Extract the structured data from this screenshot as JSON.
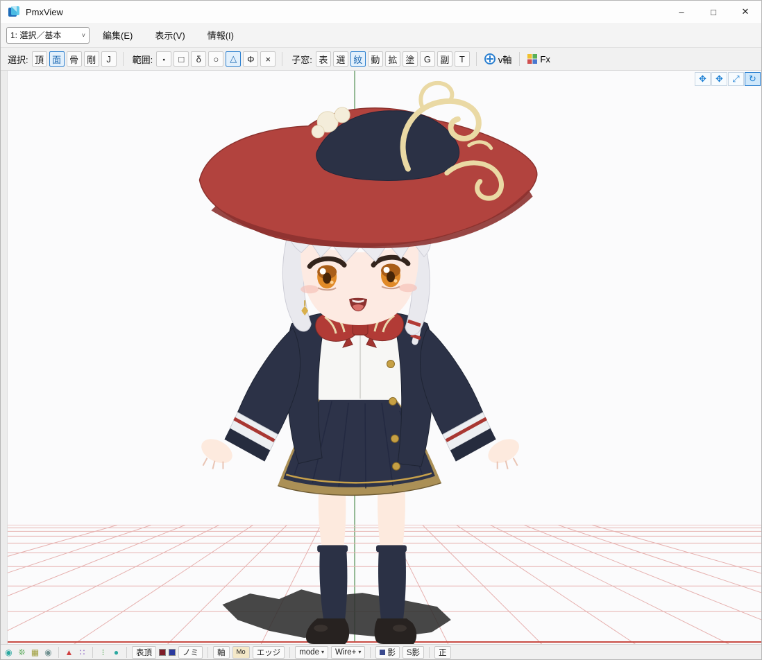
{
  "window": {
    "title": "PmxView",
    "minimize": "–",
    "maximize": "□",
    "close": "✕"
  },
  "menubar": {
    "mode_combo": {
      "value": "1: 選択／基本",
      "chevron": "˅"
    },
    "menus": [
      {
        "label": "編集(E)"
      },
      {
        "label": "表示(V)"
      },
      {
        "label": "情報(I)"
      }
    ]
  },
  "toolbar": {
    "select": {
      "label": "選択:",
      "buttons": [
        {
          "label": "頂",
          "selected": false
        },
        {
          "label": "面",
          "selected": true
        },
        {
          "label": "骨",
          "selected": false
        },
        {
          "label": "剛",
          "selected": false
        },
        {
          "label": "J",
          "selected": false
        }
      ]
    },
    "range": {
      "label": "範囲:",
      "buttons": [
        {
          "label": "・",
          "selected": false
        },
        {
          "label": "□",
          "selected": false
        },
        {
          "label": "δ",
          "selected": false
        },
        {
          "label": "○",
          "selected": false
        },
        {
          "label": "△",
          "selected": true
        },
        {
          "label": "Φ",
          "selected": false
        },
        {
          "label": "×",
          "selected": false
        }
      ]
    },
    "subwin": {
      "label": "子窓:",
      "buttons": [
        {
          "label": "表",
          "selected": false
        },
        {
          "label": "選",
          "selected": false
        },
        {
          "label": "紋",
          "selected": true
        },
        {
          "label": "動",
          "selected": false
        },
        {
          "label": "拡",
          "selected": false
        },
        {
          "label": "塗",
          "selected": false
        },
        {
          "label": "G",
          "selected": false
        },
        {
          "label": "副",
          "selected": false
        },
        {
          "label": "T",
          "selected": false
        }
      ]
    },
    "vaxis_label": "v軸",
    "fx_label": "Fx"
  },
  "viewport": {
    "controls": [
      {
        "name": "pan-view",
        "glyph": "✥",
        "active": false
      },
      {
        "name": "pan-model",
        "glyph": "✥",
        "active": false
      },
      {
        "name": "zoom",
        "glyph": "⤢",
        "active": false
      },
      {
        "name": "rotate",
        "glyph": "↻",
        "active": true
      }
    ]
  },
  "bottombar": {
    "icons": {
      "g1": "◉",
      "g2": "❊",
      "g3": "▦",
      "g4": "◉",
      "g5": "▲",
      "g6": "∷",
      "g7": "⁝",
      "g8": "●"
    },
    "labels": {
      "hyocho": "表頂",
      "nomi": "ノミ",
      "jiku": "軸",
      "mo": "Mo",
      "edge": "エッジ",
      "mode": "mode",
      "mode_caret": "▾",
      "wire": "Wire+",
      "wire_caret": "▾",
      "kage": "影",
      "skage": "S影",
      "sei": "正"
    }
  },
  "colors": {
    "accent": "#2a7fd0",
    "selected_bg": "#e2f0fc",
    "hat_red": "#b2433e",
    "uniform_navy": "#2c3247",
    "grid_pink": "#e6b0ae",
    "axis_green": "#4a8a4a",
    "axis_red": "#c84b43"
  }
}
